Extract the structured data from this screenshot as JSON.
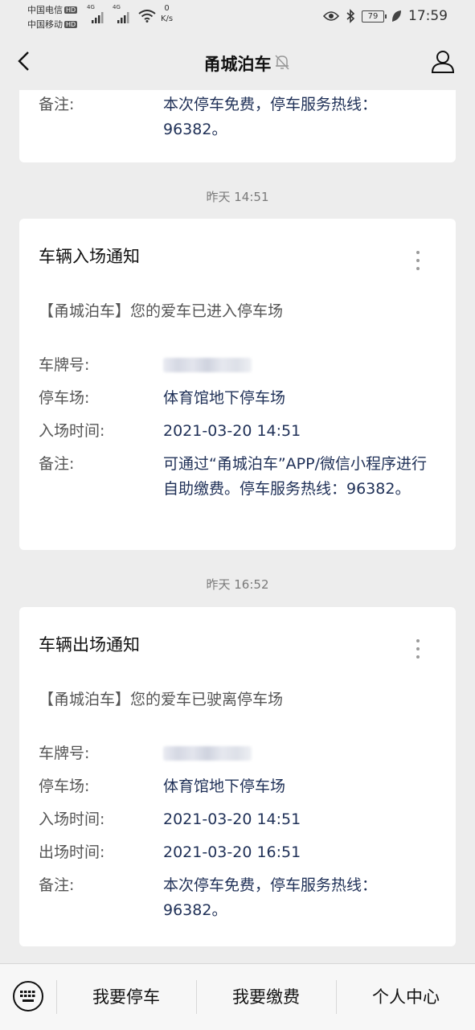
{
  "status": {
    "carrier1": "中国电信",
    "carrier2": "中国移动",
    "hd": "HD",
    "net_type": "4G",
    "speed_value": "0",
    "speed_unit": "K/s",
    "battery": "79",
    "time": "17:59"
  },
  "nav": {
    "title": "甬城泊车"
  },
  "partial_card": {
    "label": "备注:",
    "value": "本次停车免费，停车服务热线：96382。"
  },
  "messages": [
    {
      "time": "昨天 14:51",
      "title": "车辆入场通知",
      "intro": "【甬城泊车】您的爱车已进入停车场",
      "rows": [
        {
          "label": "车牌号:",
          "value": ""
        },
        {
          "label": "停车场:",
          "value": "体育馆地下停车场"
        },
        {
          "label": "入场时间:",
          "value": "2021-03-20 14:51"
        },
        {
          "label": "备注:",
          "value": "可通过“甬城泊车”APP/微信小程序进行自助缴费。停车服务热线：96382。"
        }
      ]
    },
    {
      "time": "昨天 16:52",
      "title": "车辆出场通知",
      "intro": "【甬城泊车】您的爱车已驶离停车场",
      "rows": [
        {
          "label": "车牌号:",
          "value": ""
        },
        {
          "label": "停车场:",
          "value": "体育馆地下停车场"
        },
        {
          "label": "入场时间:",
          "value": "2021-03-20 14:51"
        },
        {
          "label": "出场时间:",
          "value": "2021-03-20 16:51"
        },
        {
          "label": "备注:",
          "value": "本次停车免费，停车服务热线：96382。"
        }
      ]
    }
  ],
  "bottom_menu": [
    "我要停车",
    "我要缴费",
    "个人中心"
  ],
  "icons": [
    "wifi-icon",
    "eye-icon",
    "bluetooth-icon",
    "leaf-icon",
    "back-icon",
    "mute-bell-icon",
    "profile-icon",
    "more-icon",
    "keyboard-icon"
  ]
}
